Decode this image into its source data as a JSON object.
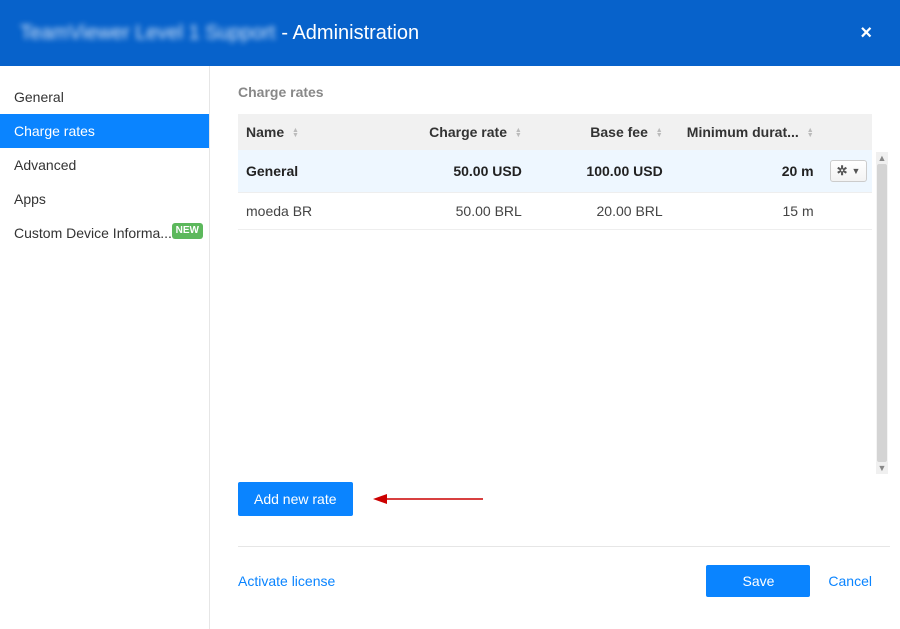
{
  "header": {
    "title_prefix_blurred": "TeamViewer Level 1 Support",
    "title_suffix": "- Administration",
    "close_label": "×"
  },
  "sidebar": {
    "items": [
      {
        "label": "General",
        "active": false,
        "badge": null
      },
      {
        "label": "Charge rates",
        "active": true,
        "badge": null
      },
      {
        "label": "Advanced",
        "active": false,
        "badge": null
      },
      {
        "label": "Apps",
        "active": false,
        "badge": null
      },
      {
        "label": "Custom Device Informa...",
        "active": false,
        "badge": "NEW"
      }
    ]
  },
  "main": {
    "section_title": "Charge rates",
    "columns": {
      "name": "Name",
      "charge_rate": "Charge rate",
      "base_fee": "Base fee",
      "min_duration": "Minimum durat...",
      "actions": ""
    },
    "rows": [
      {
        "name": "General",
        "charge_rate": "50.00 USD",
        "base_fee": "100.00 USD",
        "min_duration": "20 m",
        "selected": true
      },
      {
        "name": "moeda BR",
        "charge_rate": "50.00 BRL",
        "base_fee": "20.00 BRL",
        "min_duration": "15 m",
        "selected": false
      }
    ],
    "add_button": "Add new rate"
  },
  "footer": {
    "activate_license": "Activate license",
    "save": "Save",
    "cancel": "Cancel"
  }
}
